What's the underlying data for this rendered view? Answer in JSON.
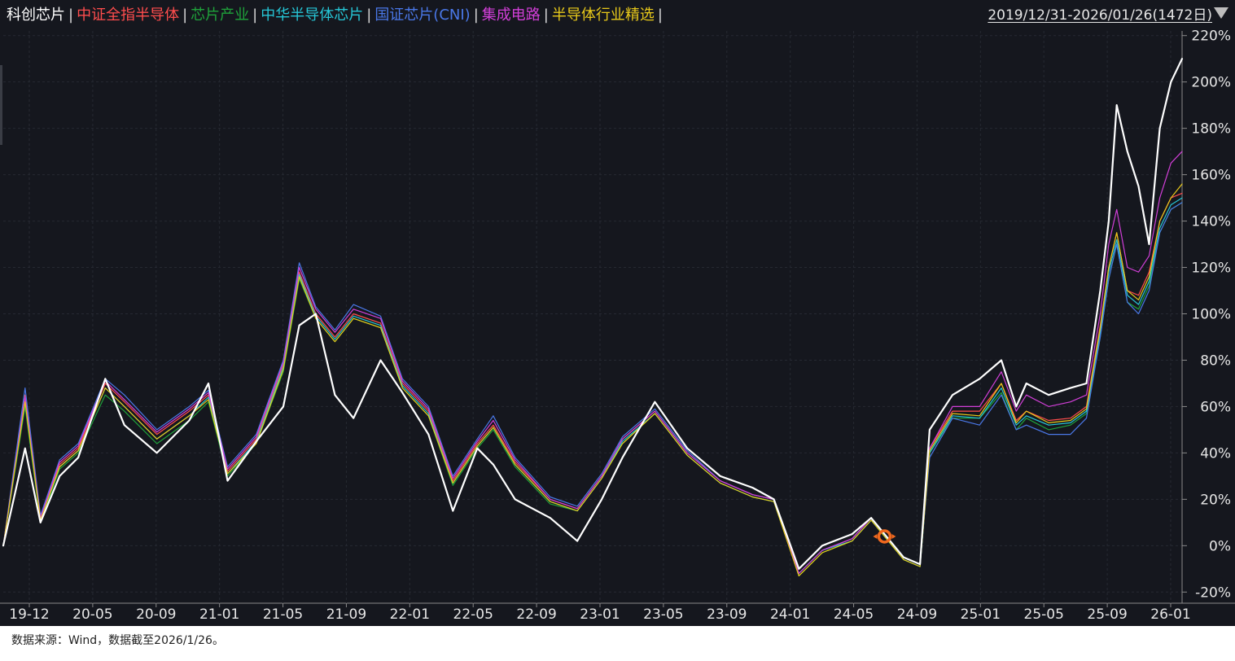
{
  "legend": [
    {
      "label": "科创芯片",
      "color": "#ffffff"
    },
    {
      "label": "中证全指半导体",
      "color": "#ff4d4d"
    },
    {
      "label": "芯片产业",
      "color": "#1fa33b"
    },
    {
      "label": "中华半导体芯片",
      "color": "#26c6d6"
    },
    {
      "label": "国证芯片(CNI)",
      "color": "#4a78e8"
    },
    {
      "label": "集成电路",
      "color": "#d23fd8"
    },
    {
      "label": "半导体行业精选",
      "color": "#e8c91a"
    }
  ],
  "separator": "|",
  "date_range": "2019/12/31-2026/01/26(1472日)",
  "footer": "数据来源：Wind，数据截至2026/1/26。",
  "chart_data": {
    "type": "line",
    "y_unit": "%",
    "ylim": [
      -22,
      222
    ],
    "y_ticks": [
      "220%",
      "200%",
      "180%",
      "160%",
      "140%",
      "120%",
      "100%",
      "80%",
      "60%",
      "40%",
      "20%",
      "0%",
      "-20%"
    ],
    "x_ticks": [
      "19-12",
      "20-05",
      "20-09",
      "21-01",
      "21-05",
      "21-09",
      "22-01",
      "22-05",
      "22-09",
      "23-01",
      "23-05",
      "23-09",
      "24-01",
      "24-05",
      "24-09",
      "25-01",
      "25-05",
      "25-09",
      "26-01"
    ],
    "grid": true,
    "legend_position": "top-left",
    "x": [
      "2019-12-31",
      "2020-02-10",
      "2020-03-10",
      "2020-04-15",
      "2020-05-20",
      "2020-07-10",
      "2020-08-15",
      "2020-10-15",
      "2020-12-15",
      "2021-01-20",
      "2021-02-25",
      "2021-04-20",
      "2021-06-10",
      "2021-07-10",
      "2021-08-10",
      "2021-09-15",
      "2021-10-20",
      "2021-12-10",
      "2022-01-20",
      "2022-03-10",
      "2022-04-25",
      "2022-06-10",
      "2022-07-10",
      "2022-08-20",
      "2022-10-25",
      "2022-12-15",
      "2023-01-30",
      "2023-03-10",
      "2023-05-10",
      "2023-07-10",
      "2023-09-10",
      "2023-11-10",
      "2023-12-20",
      "2024-02-05",
      "2024-03-20",
      "2024-05-15",
      "2024-06-20",
      "2024-08-20",
      "2024-09-20",
      "2024-10-08",
      "2024-11-20",
      "2025-01-10",
      "2025-02-20",
      "2025-03-20",
      "2025-04-08",
      "2025-05-20",
      "2025-06-30",
      "2025-07-30",
      "2025-08-25",
      "2025-09-10",
      "2025-09-25",
      "2025-10-15",
      "2025-11-05",
      "2025-11-25",
      "2025-12-15",
      "2026-01-05",
      "2026-01-26"
    ],
    "series": [
      {
        "name": "科创芯片",
        "color": "#ffffff",
        "values": [
          0,
          42,
          10,
          30,
          38,
          72,
          52,
          40,
          54,
          70,
          28,
          45,
          60,
          95,
          100,
          65,
          55,
          80,
          66,
          48,
          15,
          42,
          35,
          20,
          12,
          2,
          20,
          38,
          62,
          42,
          30,
          25,
          20,
          -10,
          0,
          5,
          12,
          -5,
          -8,
          50,
          65,
          72,
          80,
          60,
          70,
          65,
          68,
          70,
          110,
          140,
          190,
          170,
          155,
          130,
          180,
          200,
          210
        ]
      },
      {
        "name": "中证全指半导体",
        "color": "#ff4d4d",
        "values": [
          0,
          65,
          12,
          35,
          42,
          70,
          62,
          48,
          58,
          65,
          32,
          46,
          78,
          118,
          100,
          90,
          100,
          96,
          70,
          58,
          28,
          44,
          52,
          36,
          20,
          16,
          30,
          46,
          58,
          40,
          28,
          22,
          20,
          -12,
          -2,
          3,
          12,
          -5,
          -8,
          42,
          58,
          58,
          70,
          54,
          58,
          54,
          55,
          60,
          95,
          120,
          135,
          110,
          108,
          118,
          140,
          150,
          152
        ]
      },
      {
        "name": "芯片产业",
        "color": "#1fa33b",
        "values": [
          0,
          60,
          10,
          33,
          40,
          65,
          58,
          44,
          54,
          62,
          30,
          44,
          75,
          115,
          98,
          88,
          98,
          94,
          68,
          56,
          26,
          42,
          50,
          34,
          18,
          15,
          29,
          44,
          57,
          39,
          27,
          21,
          19,
          -13,
          -3,
          2,
          11,
          -6,
          -9,
          40,
          55,
          55,
          66,
          50,
          55,
          50,
          52,
          57,
          90,
          115,
          130,
          105,
          102,
          112,
          135,
          145,
          148
        ]
      },
      {
        "name": "中华半导体芯片",
        "color": "#26c6d6",
        "values": [
          0,
          63,
          11,
          34,
          41,
          68,
          60,
          46,
          56,
          64,
          31,
          45,
          77,
          117,
          99,
          89,
          99,
          95,
          69,
          57,
          27,
          43,
          51,
          35,
          19,
          15,
          29,
          45,
          57,
          39,
          27,
          21,
          19,
          -12,
          -2,
          2,
          11,
          -6,
          -9,
          40,
          56,
          55,
          68,
          52,
          56,
          52,
          53,
          58,
          92,
          118,
          132,
          108,
          104,
          114,
          137,
          147,
          150
        ]
      },
      {
        "name": "国证芯片(CNI)",
        "color": "#4a78e8",
        "values": [
          0,
          68,
          13,
          37,
          44,
          72,
          65,
          50,
          60,
          67,
          34,
          48,
          80,
          122,
          103,
          93,
          104,
          99,
          72,
          60,
          30,
          46,
          56,
          38,
          21,
          17,
          31,
          47,
          59,
          41,
          28,
          22,
          20,
          -12,
          -2,
          3,
          12,
          -5,
          -8,
          38,
          55,
          52,
          65,
          50,
          52,
          48,
          48,
          55,
          90,
          115,
          130,
          105,
          100,
          110,
          135,
          145,
          148
        ]
      },
      {
        "name": "集成电路",
        "color": "#d23fd8",
        "values": [
          0,
          64,
          12,
          36,
          43,
          71,
          63,
          49,
          59,
          66,
          33,
          47,
          79,
          120,
          102,
          92,
          102,
          98,
          71,
          59,
          29,
          45,
          54,
          37,
          20,
          16,
          30,
          46,
          58,
          40,
          28,
          22,
          20,
          -12,
          -2,
          3,
          12,
          -5,
          -8,
          42,
          60,
          60,
          75,
          58,
          65,
          60,
          62,
          65,
          100,
          130,
          145,
          120,
          118,
          125,
          150,
          165,
          170
        ]
      },
      {
        "name": "半导体行业精选",
        "color": "#e8c91a",
        "values": [
          0,
          62,
          11,
          34,
          41,
          68,
          60,
          46,
          56,
          63,
          31,
          44,
          76,
          116,
          98,
          88,
          98,
          94,
          68,
          56,
          27,
          43,
          51,
          35,
          19,
          15,
          29,
          44,
          57,
          39,
          27,
          21,
          19,
          -13,
          -3,
          2,
          11,
          -6,
          -9,
          41,
          57,
          56,
          70,
          53,
          58,
          53,
          54,
          59,
          94,
          120,
          135,
          110,
          106,
          116,
          140,
          150,
          156
        ]
      }
    ]
  }
}
